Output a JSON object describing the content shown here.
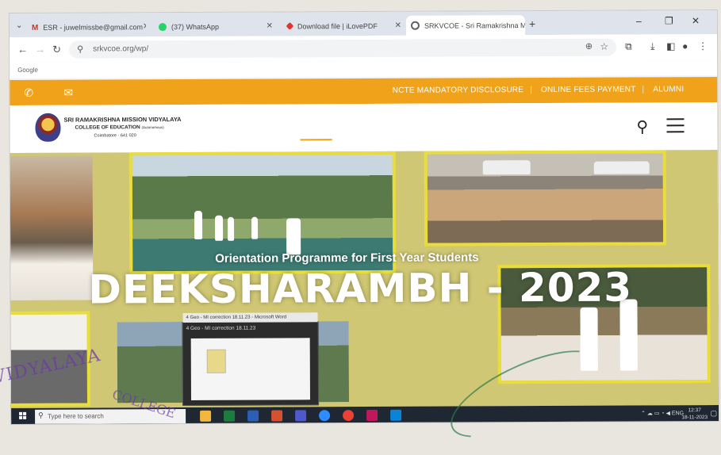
{
  "browser": {
    "tabs": [
      {
        "label": "ESR - juwelmissbe@gmail.com",
        "fav_color": "#d93025",
        "fav_glyph": "M"
      },
      {
        "label": "(37) WhatsApp",
        "fav_color": "#25d366"
      },
      {
        "label": "Download file | iLovePDF",
        "fav_color": "#e5322d"
      },
      {
        "label": "SRKVCOE - Sri Ramakrishna Mission...",
        "fav_color": "#5f6368"
      }
    ],
    "url": "srkvcoe.org/wp/",
    "bookmark": "Google"
  },
  "site": {
    "top_links": [
      "NCTE MANDATORY DISCLOSURE",
      "ONLINE FEES PAYMENT",
      "ALUMNI"
    ],
    "college": {
      "line1": "SRI RAMAKRISHNA MISSION VIDYALAYA",
      "line2": "COLLEGE OF EDUCATION",
      "line2_suffix": "(Autonomous)",
      "line3": "Coimbatore - 641 020"
    },
    "accent_color": "#f0a21b",
    "hero": {
      "subtitle": "Orientation Programme for First Year Students",
      "title": "DEEKSHARAMBH - 2023"
    }
  },
  "preview": {
    "tooltip": "4 Geo - MI correction 18.11.23 - Microsoft Word",
    "title": "4 Geo - MI correction 18.11.23"
  },
  "taskbar": {
    "search_placeholder": "Type here to search",
    "language": "ENG",
    "time": "12:37",
    "date": "18-11-2023"
  },
  "stamp": {
    "text": "VIDYALAYA",
    "text2": "COLLEGE"
  }
}
